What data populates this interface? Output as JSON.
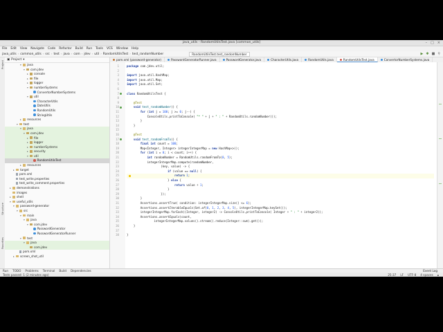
{
  "window": {
    "title": "java_utils - RandomUtilsTest.java [common_utils]"
  },
  "menu": [
    "File",
    "Edit",
    "View",
    "Navigate",
    "Code",
    "Refactor",
    "Build",
    "Run",
    "Tools",
    "VCS",
    "Window",
    "Help"
  ],
  "breadcrumbs": [
    "java_utils",
    "common_utils",
    "src",
    "test",
    "java",
    "com",
    "jdev",
    "util",
    "RandomUtilsTest",
    "test_randomNumber"
  ],
  "run_config": "RandomUtilsTest.test_randomNumber",
  "project_panel": {
    "title": "Project"
  },
  "tree": [
    {
      "label": "java",
      "depth": 4,
      "icon": "folder",
      "arrow": "v",
      "state": ""
    },
    {
      "label": "com.jdev",
      "depth": 5,
      "icon": "pkg",
      "arrow": "v",
      "state": ""
    },
    {
      "label": "console",
      "depth": 6,
      "icon": "pkg",
      "arrow": ">",
      "state": ""
    },
    {
      "label": "file",
      "depth": 6,
      "icon": "pkg",
      "arrow": ">",
      "state": ""
    },
    {
      "label": "logger",
      "depth": 6,
      "icon": "pkg",
      "arrow": ">",
      "state": ""
    },
    {
      "label": "numberSystems",
      "depth": 6,
      "icon": "pkg",
      "arrow": "v",
      "state": ""
    },
    {
      "label": "ConvertorNumberSystems",
      "depth": 7,
      "icon": "cls",
      "arrow": "",
      "state": ""
    },
    {
      "label": "util",
      "depth": 6,
      "icon": "pkg",
      "arrow": "v",
      "state": ""
    },
    {
      "label": "CharacterUtils",
      "depth": 7,
      "icon": "cls",
      "arrow": "",
      "state": ""
    },
    {
      "label": "DateUtils",
      "depth": 7,
      "icon": "cls",
      "arrow": "",
      "state": ""
    },
    {
      "label": "RandomUtils",
      "depth": 7,
      "icon": "cls",
      "arrow": "",
      "state": ""
    },
    {
      "label": "StringUtils",
      "depth": 7,
      "icon": "cls",
      "arrow": "",
      "state": ""
    },
    {
      "label": "resources",
      "depth": 4,
      "icon": "folder",
      "arrow": ">",
      "state": ""
    },
    {
      "label": "test",
      "depth": 3,
      "icon": "folder",
      "arrow": "v",
      "state": ""
    },
    {
      "label": "java",
      "depth": 4,
      "icon": "folder",
      "arrow": "v",
      "state": "test"
    },
    {
      "label": "com.jdev",
      "depth": 5,
      "icon": "pkg",
      "arrow": "v",
      "state": "test"
    },
    {
      "label": "file",
      "depth": 6,
      "icon": "pkg",
      "arrow": ">",
      "state": "test"
    },
    {
      "label": "logger",
      "depth": 6,
      "icon": "pkg",
      "arrow": ">",
      "state": "test"
    },
    {
      "label": "numberSystems",
      "depth": 6,
      "icon": "pkg",
      "arrow": ">",
      "state": "test"
    },
    {
      "label": "security",
      "depth": 6,
      "icon": "pkg",
      "arrow": ">",
      "state": "test"
    },
    {
      "label": "util",
      "depth": 6,
      "icon": "pkg",
      "arrow": "v",
      "state": "test"
    },
    {
      "label": "RandomUtilsTest",
      "depth": 7,
      "icon": "tcls",
      "arrow": "",
      "state": "sel"
    },
    {
      "label": "resources",
      "depth": 4,
      "icon": "folder",
      "arrow": ">",
      "state": ""
    },
    {
      "label": "target",
      "depth": 2,
      "icon": "folder",
      "arrow": ">",
      "state": ""
    },
    {
      "label": "pom.xml",
      "depth": 2,
      "icon": "file",
      "arrow": "",
      "state": ""
    },
    {
      "label": "test_write.properties",
      "depth": 2,
      "icon": "file",
      "arrow": "",
      "state": ""
    },
    {
      "label": "test_write_comment.properties",
      "depth": 2,
      "icon": "file",
      "arrow": "",
      "state": ""
    },
    {
      "label": "demonstrations",
      "depth": 1,
      "icon": "folder",
      "arrow": ">",
      "state": ""
    },
    {
      "label": "images",
      "depth": 1,
      "icon": "folder",
      "arrow": "",
      "state": ""
    },
    {
      "label": "shell",
      "depth": 1,
      "icon": "folder",
      "arrow": ">",
      "state": ""
    },
    {
      "label": "useful_utils",
      "depth": 1,
      "icon": "folder",
      "arrow": "v",
      "state": ""
    },
    {
      "label": "password-generator",
      "depth": 2,
      "icon": "folder",
      "arrow": "v",
      "state": ""
    },
    {
      "label": "src",
      "depth": 3,
      "icon": "folder",
      "arrow": "v",
      "state": ""
    },
    {
      "label": "main",
      "depth": 4,
      "icon": "folder",
      "arrow": "v",
      "state": ""
    },
    {
      "label": "java",
      "depth": 5,
      "icon": "folder",
      "arrow": "v",
      "state": ""
    },
    {
      "label": "com.jdev",
      "depth": 6,
      "icon": "pkg",
      "arrow": "v",
      "state": ""
    },
    {
      "label": "PasswordGenerator",
      "depth": 7,
      "icon": "cls",
      "arrow": "",
      "state": ""
    },
    {
      "label": "PasswordGeneratorRunner",
      "depth": 7,
      "icon": "cls",
      "arrow": "",
      "state": ""
    },
    {
      "label": "test",
      "depth": 4,
      "icon": "folder",
      "arrow": "v",
      "state": ""
    },
    {
      "label": "java",
      "depth": 5,
      "icon": "folder",
      "arrow": "v",
      "state": "test"
    },
    {
      "label": "com.jdev",
      "depth": 6,
      "icon": "pkg",
      "arrow": "",
      "state": "test"
    },
    {
      "label": "pom.xml",
      "depth": 3,
      "icon": "file",
      "arrow": "",
      "state": ""
    },
    {
      "label": "screen_shot_util",
      "depth": 2,
      "icon": "folder",
      "arrow": ">",
      "state": ""
    }
  ],
  "tabs": [
    {
      "label": "pom.xml (password-generator)",
      "kind": "file",
      "active": false
    },
    {
      "label": "PasswordGeneratorRunner.java",
      "kind": "cls",
      "active": false
    },
    {
      "label": "PasswordGenerator.java",
      "kind": "cls",
      "active": false
    },
    {
      "label": "CharacterUtils.java",
      "kind": "cls",
      "active": false
    },
    {
      "label": "RandomUtils.java",
      "kind": "cls",
      "active": false
    },
    {
      "label": "RandomUtilsTest.java",
      "kind": "tst",
      "active": true
    },
    {
      "label": "ConvertorNumberSystems.java",
      "kind": "cls",
      "active": false
    }
  ],
  "code_lines": [
    {
      "n": "1",
      "html": "<span class='kw'>package</span> com.jdev.util;",
      "mark": "",
      "caret": false
    },
    {
      "n": "2",
      "html": "",
      "mark": "",
      "caret": false
    },
    {
      "n": "3",
      "html": "<span class='kw'>import</span> java.util.HashMap;",
      "mark": "",
      "caret": false
    },
    {
      "n": "4",
      "html": "<span class='kw'>import</span> java.util.Map;",
      "mark": "",
      "caret": false
    },
    {
      "n": "5",
      "html": "<span class='kw'>import</span> java.util.Set;",
      "mark": "",
      "caret": false
    },
    {
      "n": "6",
      "html": "",
      "mark": "",
      "caret": false
    },
    {
      "n": "7",
      "html": "<span class='kw'>class</span> RandomUtilsTest {",
      "mark": "run",
      "caret": false
    },
    {
      "n": "8",
      "html": "",
      "mark": "",
      "caret": false
    },
    {
      "n": "9",
      "html": "    <span class='an'>@Test</span>",
      "mark": "",
      "caret": false
    },
    {
      "n": "10",
      "html": "    <span class='kw'>void</span> <span class='fn'>test_randomNumber</span>() {",
      "mark": "run",
      "caret": false
    },
    {
      "n": "11",
      "html": "        <span class='kw'>for</span> (<span class='kw'>int</span> j = <span class='num'>100</span>; j &gt;= <span class='num'>0</span>; j--) {",
      "mark": "",
      "caret": false
    },
    {
      "n": "12",
      "html": "            ConsoleUtils.<span class='itl'>printToConsole</span>( <span class='str'>\"* \"</span> + j + <span class='str'>\" : \"</span> + RandomUtils.<span class='itl'>randomNumber</span>());",
      "mark": "",
      "caret": false
    },
    {
      "n": "13",
      "html": "        }",
      "mark": "",
      "caret": false
    },
    {
      "n": "14",
      "html": "    }",
      "mark": "",
      "caret": false
    },
    {
      "n": "15",
      "html": "",
      "mark": "",
      "caret": false
    },
    {
      "n": "16",
      "html": "    <span class='an'>@Test</span>",
      "mark": "",
      "caret": false
    },
    {
      "n": "17",
      "html": "    <span class='kw'>void</span> <span class='fn'>test_randomFromTo</span>() {",
      "mark": "run",
      "caret": false
    },
    {
      "n": "18",
      "html": "        <span class='kw'>final int</span> count = <span class='num'>100</span>;",
      "mark": "",
      "caret": false
    },
    {
      "n": "19",
      "html": "        Map&lt;Integer, Integer&gt; integerIntegerMap = <span class='kw'>new</span> HashMap&lt;&gt;();",
      "mark": "",
      "caret": false
    },
    {
      "n": "20",
      "html": "        <span class='kw'>for</span> (<span class='kw'>int</span> i = <span class='num'>0</span>; i &lt; count; i++) {",
      "mark": "",
      "caret": false
    },
    {
      "n": "21",
      "html": "            <span class='kw'>int</span> randomNumber = RandomUtils.<span class='itl'>randomFromTo</span>(<span class='num'>0</span>, <span class='num'>5</span>);",
      "mark": "",
      "caret": false
    },
    {
      "n": "22",
      "html": "            integerIntegerMap.compute(randomNumber,",
      "mark": "",
      "caret": false
    },
    {
      "n": "23",
      "html": "                    (key, value) -&gt; {",
      "mark": "",
      "caret": false
    },
    {
      "n": "24",
      "html": "                        <span class='kw'>if</span> (value == <span class='kw'>null</span>) {",
      "mark": "",
      "caret": false
    },
    {
      "n": "25",
      "html": "                            <span class='kw'>return</span> <span class='num'>1</span>;",
      "mark": "bulb",
      "caret": true
    },
    {
      "n": "26",
      "html": "                        } <span class='kw'>else</span> {",
      "mark": "",
      "caret": false
    },
    {
      "n": "27",
      "html": "                            <span class='kw'>return</span> value + <span class='num'>1</span>;",
      "mark": "",
      "caret": false
    },
    {
      "n": "28",
      "html": "                        }",
      "mark": "",
      "caret": false
    },
    {
      "n": "29",
      "html": "                    });",
      "mark": "",
      "caret": false
    },
    {
      "n": "30",
      "html": "        }",
      "mark": "",
      "caret": false
    },
    {
      "n": "31",
      "html": "        Assertions.<span class='itl'>assertTrue</span>( condition: integerIntegerMap.size() &lt;= <span class='num'>6</span>);",
      "mark": "",
      "caret": false
    },
    {
      "n": "32",
      "html": "        Assertions.<span class='itl'>assertIterableEquals</span>(Set.<span class='itl'>of</span>(<span class='num'>0</span>, <span class='num'>1</span>, <span class='num'>2</span>, <span class='num'>3</span>, <span class='num'>4</span>, <span class='num'>5</span>), integerIntegerMap.keySet());",
      "mark": "",
      "caret": false
    },
    {
      "n": "33",
      "html": "        integerIntegerMap.forEach((Integer, integer2) -&gt; ConsoleUtils.<span class='itl'>printToConsole</span>( Integer + <span class='str'>\" : \"</span> + integer2));",
      "mark": "",
      "caret": false
    },
    {
      "n": "34",
      "html": "        Assertions.<span class='itl'>assertEquals</span>(count,",
      "mark": "",
      "caret": false
    },
    {
      "n": "35",
      "html": "                integerIntegerMap.values().stream().reduce(Integer::<span class='itl'>sum</span>).get());",
      "mark": "",
      "caret": false
    },
    {
      "n": "36",
      "html": "    }",
      "mark": "",
      "caret": false
    },
    {
      "n": "37",
      "html": "",
      "mark": "",
      "caret": false
    },
    {
      "n": "38",
      "html": "}",
      "mark": "",
      "caret": false
    }
  ],
  "bottom_tools": [
    "Run",
    "TODO",
    "Problems",
    "Terminal",
    "Build",
    "Dependencies"
  ],
  "event_log": "Event Log",
  "status": {
    "message": "Tests passed: 1 (2 minutes ago)",
    "position": "25:37",
    "line_sep": "LF",
    "encoding": "UTF-8",
    "indent": "4 spaces"
  },
  "side_labels": [
    "Project",
    "Structure",
    "Favorites"
  ]
}
